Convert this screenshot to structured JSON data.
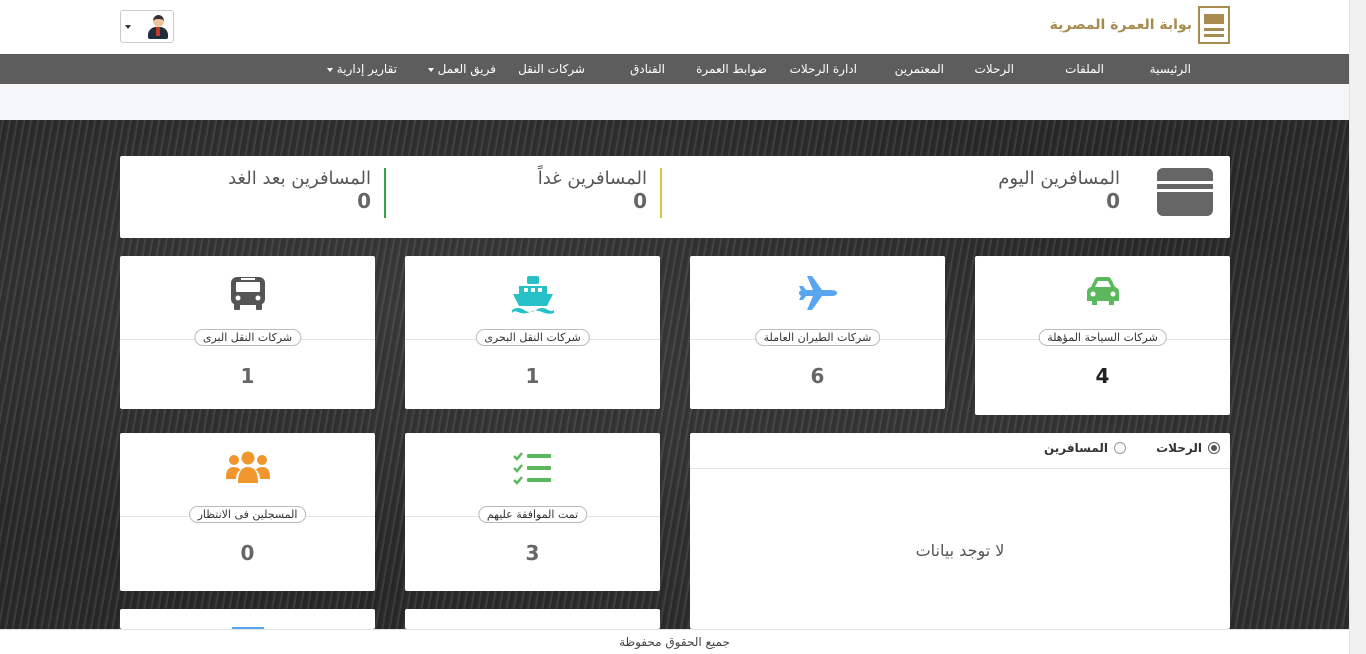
{
  "header": {
    "logo_text": "بوابة العمرة المصرية"
  },
  "nav": {
    "items": [
      {
        "label": "الرئيسية"
      },
      {
        "label": "الملفات"
      },
      {
        "label": "الرحلات"
      },
      {
        "label": "المعتمرين"
      },
      {
        "label": "ادارة الرحلات"
      },
      {
        "label": "ضوابط العمرة"
      },
      {
        "label": "الفنادق"
      },
      {
        "label": "شركات النقل"
      },
      {
        "label": "فريق العمل",
        "dropdown": true
      },
      {
        "label": "تقارير إدارية",
        "dropdown": true
      }
    ]
  },
  "summary": {
    "today_label": "المسافرين اليوم",
    "today_value": "0",
    "tomorrow_label": "المسافرين غداً",
    "tomorrow_value": "0",
    "after_label": "المسافرين بعد الغد",
    "after_value": "0",
    "colors": {
      "tomorrow_divider": "#d6c637",
      "after_divider": "#3aa14a"
    }
  },
  "cards": [
    {
      "icon": "car-icon",
      "label": "شركات السياحة المؤهلة",
      "value": "4",
      "color": "#5cb85c"
    },
    {
      "icon": "airplane-icon",
      "label": "شركات الطيران العاملة",
      "value": "6",
      "color": "#5aa5f0"
    },
    {
      "icon": "ship-icon",
      "label": "شركات النقل البحرى",
      "value": "1",
      "color": "#25c0c8"
    },
    {
      "icon": "bus-icon",
      "label": "شركات النقل البرى",
      "value": "1",
      "color": "#555555"
    },
    {
      "icon": "checklist-icon",
      "label": "تمت الموافقة عليهم",
      "value": "3",
      "color": "#5cb85c"
    },
    {
      "icon": "users-icon",
      "label": "المسجلين فى الانتظار",
      "value": "0",
      "color": "#f0962d"
    }
  ],
  "chart": {
    "option_trips": "الرحلات",
    "option_travelers": "المسافرين",
    "selected": "الرحلات",
    "empty_text": "لا توجد بيانات"
  },
  "footer": {
    "text": "جميع الحقوق محفوظة"
  }
}
